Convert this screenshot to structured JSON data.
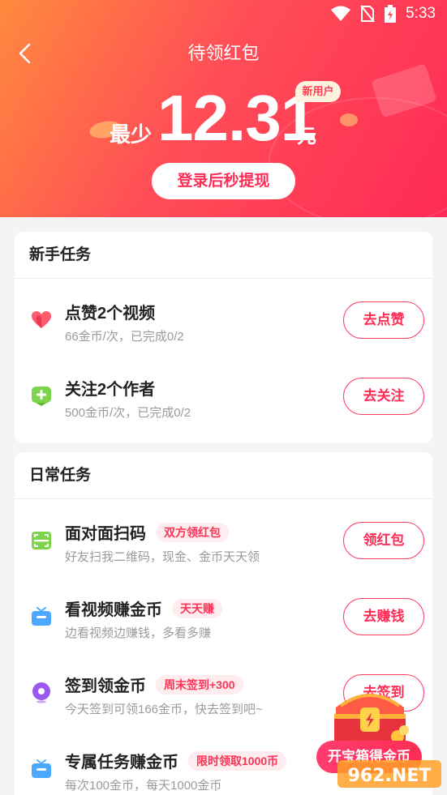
{
  "status": {
    "time": "5:33"
  },
  "header": {
    "title": "待领红包",
    "amount_prefix": "最少",
    "amount": "12.31",
    "amount_unit": "元",
    "badge": "新用户",
    "withdraw_button": "登录后秒提现"
  },
  "newbie": {
    "title": "新手任务",
    "tasks": [
      {
        "icon": "heart-icon",
        "name": "点赞2个视频",
        "desc": "66金币/次，已完成0/2",
        "button": "去点赞"
      },
      {
        "icon": "follow-icon",
        "name": "关注2个作者",
        "desc": "500金币/次，已完成0/2",
        "button": "去关注"
      }
    ]
  },
  "daily": {
    "title": "日常任务",
    "tasks": [
      {
        "icon": "scan-icon",
        "name": "面对面扫码",
        "tag": "双方领红包",
        "desc": "好友扫我二维码，现金、金币天天领",
        "button": "领红包"
      },
      {
        "icon": "tv-icon",
        "name": "看视频赚金币",
        "tag": "天天赚",
        "desc": "边看视频边赚钱，多看多赚",
        "button": "去赚钱"
      },
      {
        "icon": "location-icon",
        "name": "签到领金币",
        "tag": "周末签到+300",
        "desc": "今天签到可领166金币，快去签到吧~",
        "button": "去签到"
      },
      {
        "icon": "tv-icon",
        "name": "专属任务赚金币",
        "tag": "限时领取1000币",
        "desc": "每次100金币，每天1000金币",
        "button": ""
      }
    ]
  },
  "floating": {
    "button": "开宝箱得金币",
    "watermark": "962.NET"
  },
  "colors": {
    "accent": "#ff2d55",
    "header_start": "#ff8a3d",
    "header_end": "#ff2a55"
  }
}
